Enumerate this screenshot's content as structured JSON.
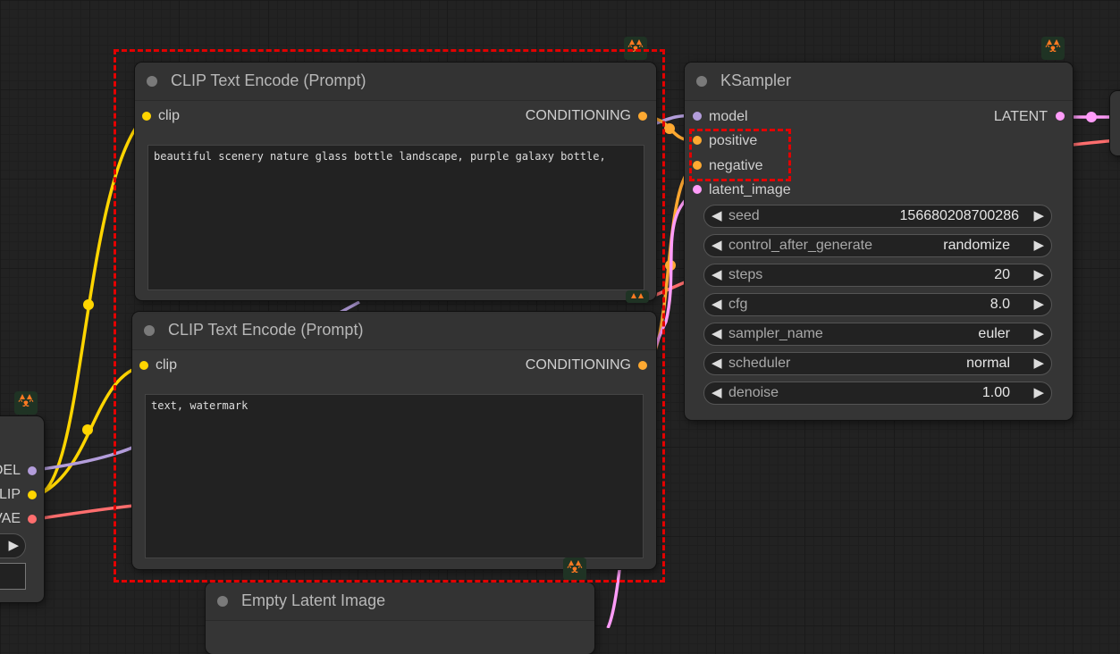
{
  "colors": {
    "clip": "#ffd500",
    "conditioning": "#ffa931",
    "model": "#b39ddb",
    "latent": "#ff9cf9",
    "vae": "#ff6e6e",
    "highlight": "#e30000"
  },
  "badge_icon": "fox-icon",
  "clip_node_1": {
    "title": "CLIP Text Encode (Prompt)",
    "input": "clip",
    "output": "CONDITIONING",
    "text": "beautiful scenery nature glass bottle landscape, purple galaxy bottle,"
  },
  "clip_node_2": {
    "title": "CLIP Text Encode (Prompt)",
    "input": "clip",
    "output": "CONDITIONING",
    "text": "text, watermark"
  },
  "ksampler": {
    "title": "KSampler",
    "inputs": [
      "model",
      "positive",
      "negative",
      "latent_image"
    ],
    "output": "LATENT",
    "widgets": [
      {
        "label": "seed",
        "value": "156680208700286"
      },
      {
        "label": "control_after_generate",
        "value": "randomize"
      },
      {
        "label": "steps",
        "value": "20"
      },
      {
        "label": "cfg",
        "value": "8.0"
      },
      {
        "label": "sampler_name",
        "value": "euler"
      },
      {
        "label": "scheduler",
        "value": "normal"
      },
      {
        "label": "denoise",
        "value": "1.00"
      }
    ]
  },
  "checkpoint_partial": {
    "outputs": [
      "DEL",
      "LIP",
      "VAE"
    ]
  },
  "empty_latent": {
    "title": "Empty Latent Image"
  }
}
